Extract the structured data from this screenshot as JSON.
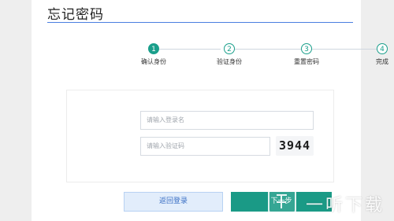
{
  "page": {
    "title": "忘记密码"
  },
  "steps": [
    {
      "number": "1",
      "label": "确认身份",
      "active": true
    },
    {
      "number": "2",
      "label": "验证身份",
      "active": false
    },
    {
      "number": "3",
      "label": "重置密码",
      "active": false
    },
    {
      "number": "4",
      "label": "完成",
      "active": false
    }
  ],
  "form": {
    "login_placeholder": "请输入登录名",
    "captcha_placeholder": "请输入验证码",
    "captcha_code": "3944"
  },
  "buttons": {
    "back_label": "返回登录",
    "next_label": "下一步"
  },
  "watermark": {
    "text": "一听下载"
  },
  "colors": {
    "accent": "#1a9f8b",
    "title_underline": "#4a7fe0",
    "back_button_bg": "#e2edfb",
    "next_button_bg": "#1a9a86"
  }
}
